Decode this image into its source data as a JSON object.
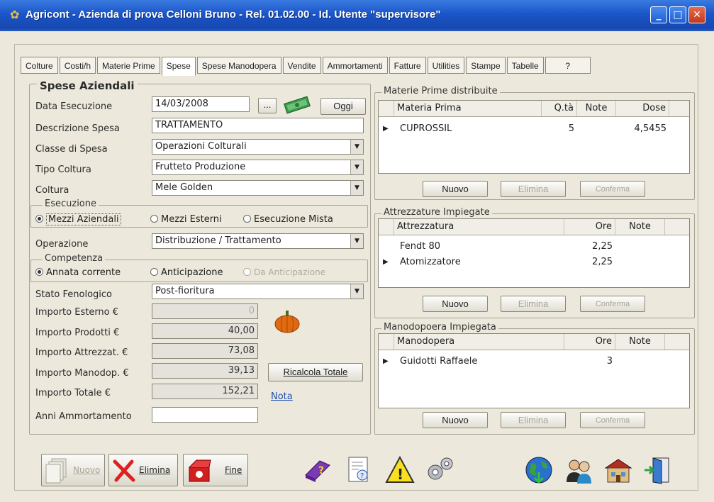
{
  "window": {
    "title": "Agricont  - Azienda di prova Celloni Bruno - Rel. 01.02.00 - Id. Utente \"supervisore\""
  },
  "tabs": [
    "Colture",
    "Costi/h",
    "Materie Prime",
    "Spese",
    "Spese Manodopera",
    "Vendite",
    "Ammortamenti",
    "Fatture",
    "Utilities",
    "Stampe",
    "Tabelle",
    "?"
  ],
  "active_tab": "Spese",
  "spese": {
    "section_title": "Spese Aziendali",
    "data_esecuzione_label": "Data Esecuzione",
    "data_esecuzione": "14/03/2008",
    "dots_label": "...",
    "oggi_label": "Oggi",
    "descrizione_label": "Descrizione Spesa",
    "descrizione": "TRATTAMENTO",
    "classe_label": "Classe di Spesa",
    "classe": "Operazioni Colturali",
    "tipo_coltura_label": "Tipo Coltura",
    "tipo_coltura": "Frutteto Produzione",
    "coltura_label": "Coltura",
    "coltura": "Mele Golden",
    "esecuzione_group": "Esecuzione",
    "esecuzione_options": [
      "Mezzi Aziendali",
      "Mezzi Esterni",
      "Esecuzione Mista"
    ],
    "operazione_label": "Operazione",
    "operazione": "Distribuzione / Trattamento",
    "competenza_group": "Competenza",
    "competenza_options": [
      "Annata corrente",
      "Anticipazione",
      "Da Anticipazione"
    ],
    "stato_label": "Stato Fenologico",
    "stato": "Post-fioritura",
    "importo_esterno_label": "Importo Esterno €",
    "importo_esterno": "0",
    "importo_prodotti_label": "Importo Prodotti €",
    "importo_prodotti": "40,00",
    "importo_attrezzat_label": "Importo Attrezzat. €",
    "importo_attrezzat": "73,08",
    "importo_manodop_label": "Importo Manodop. €",
    "importo_manodop": "39,13",
    "importo_totale_label": "Importo Totale €",
    "importo_totale": "152,21",
    "anni_label": "Anni Ammortamento",
    "anni": "",
    "ricalcola_label": "Ricalcola Totale",
    "nota_label": "Nota"
  },
  "materie": {
    "group": "Materie Prime distribuite",
    "headers": [
      "Materia Prima",
      "Q.tà",
      "Note",
      "Dose"
    ],
    "rows": [
      {
        "name": "CUPROSSIL",
        "qta": "5",
        "note": "",
        "dose": "4,5455"
      }
    ]
  },
  "attrezzature": {
    "group": "Attrezzature Impiegate",
    "headers": [
      "Attrezzatura",
      "Ore",
      "Note"
    ],
    "rows": [
      {
        "name": "Fendt 80",
        "ore": "2,25"
      },
      {
        "name": "Atomizzatore",
        "ore": "2,25"
      }
    ]
  },
  "manodopera": {
    "group": "Manodopoera Impiegata",
    "headers": [
      "Manodopera",
      "Ore",
      "Note"
    ],
    "rows": [
      {
        "name": "Guidotti Raffaele",
        "ore": "3"
      }
    ]
  },
  "grid_buttons": {
    "nuovo": "Nuovo",
    "elimina": "Elimina",
    "conferma": "Conferma"
  },
  "toolbar": {
    "nuovo": "Nuovo",
    "elimina": "Elimina",
    "fine": "Fine"
  }
}
